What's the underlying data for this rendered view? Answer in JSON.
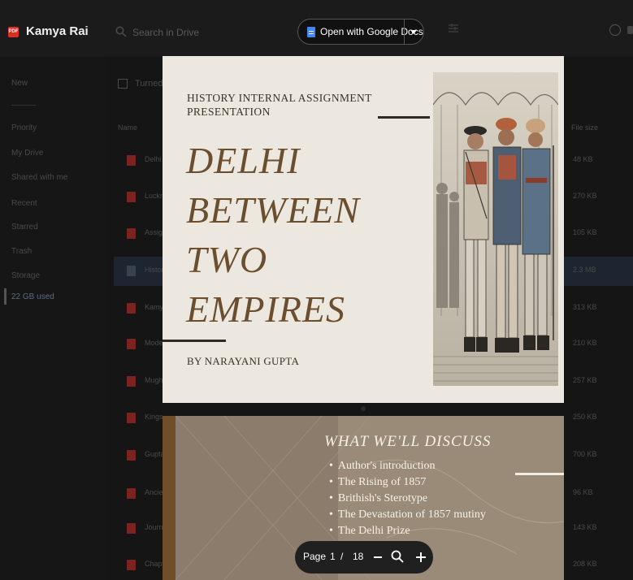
{
  "header": {
    "file_title": "Kamya Rai",
    "file_badge": "PDF",
    "search_placeholder": "Search in Drive",
    "open_with_label": "Open with Google Docs"
  },
  "sidebar": {
    "new_label": "New",
    "items": [
      "Priority",
      "My Drive",
      "Shared with me",
      "Recent",
      "Starred",
      "Trash",
      "Storage",
      "22 GB used"
    ]
  },
  "file_list": {
    "header": "Turned in",
    "columns": {
      "name": "Name",
      "size": "File size"
    },
    "rows": [
      {
        "name": "Delhi",
        "size": "48 KB"
      },
      {
        "name": "Lucknow",
        "size": "270 KB"
      },
      {
        "name": "Assignment",
        "size": "105 KB"
      },
      {
        "name": "History",
        "size": "2.3 MB"
      },
      {
        "name": "Kamya",
        "size": "313 KB"
      },
      {
        "name": "Modern",
        "size": "210 KB"
      },
      {
        "name": "Mughal",
        "size": "257 KB"
      },
      {
        "name": "Kings",
        "size": "250 KB"
      },
      {
        "name": "Gupta",
        "size": "700 KB"
      },
      {
        "name": "Ancient",
        "size": "96 KB"
      },
      {
        "name": "Journal",
        "size": "143 KB"
      },
      {
        "name": "Chapter",
        "size": "208 KB"
      }
    ]
  },
  "slide1": {
    "subtitle": "HISTORY INTERNAL ASSIGNMENT PRESENTATION",
    "title_lines": [
      "DELHI",
      "BETWEEN",
      "TWO",
      "EMPIRES"
    ],
    "author": "BY NARAYANI GUPTA",
    "colors": {
      "background": "#ece8df",
      "title": "#6b4e2e",
      "text": "#3a3226"
    }
  },
  "slide2": {
    "title": "WHAT WE'LL DISCUSS",
    "items": [
      "Author's introduction",
      "The Rising of 1857",
      "Brithish's Sterotype",
      "The Devastation of 1857 mutiny",
      "The Delhi Prize"
    ]
  },
  "page_controls": {
    "page_label": "Page",
    "current_page": "1",
    "separator": "/",
    "total_pages": "18"
  }
}
